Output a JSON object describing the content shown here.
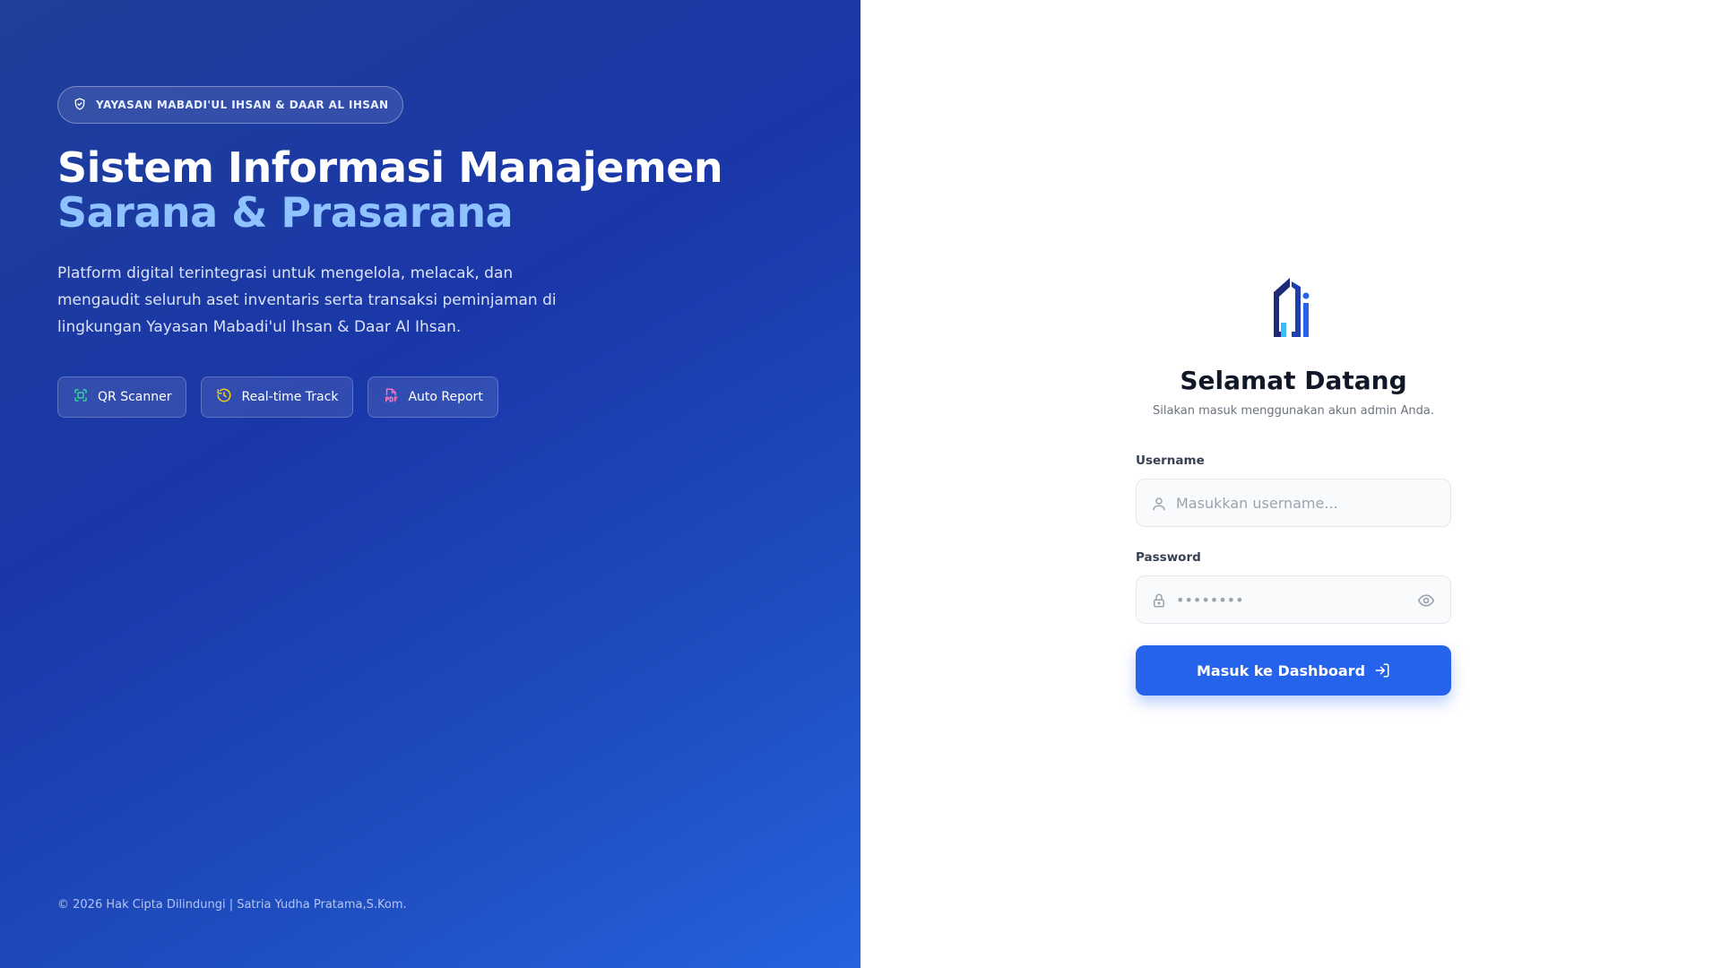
{
  "hero": {
    "badge": {
      "icon": "shield-check-icon",
      "label": "YAYASAN MABADI'UL IHSAN & DAAR AL IHSAN"
    },
    "title_line1": "Sistem Informasi Manajemen",
    "title_line2": "Sarana & Prasarana",
    "description": "Platform digital terintegrasi untuk mengelola, melacak, dan mengaudit seluruh aset inventaris serta transaksi peminjaman di lingkungan Yayasan Mabadi'ul Ihsan & Daar Al Ihsan.",
    "features": [
      {
        "icon": "qr-scan-icon",
        "label": "QR Scanner"
      },
      {
        "icon": "history-icon",
        "label": "Real-time Track"
      },
      {
        "icon": "pdf-file-icon",
        "label": "Auto Report"
      }
    ],
    "copyright": "© 2026 Hak Cipta Dilindungi | Satria Yudha Pratama,S.Kom."
  },
  "login": {
    "logo_icon": "building-logo-icon",
    "title": "Selamat Datang",
    "subtitle": "Silakan masuk menggunakan akun admin Anda.",
    "username_label": "Username",
    "username_placeholder": "Masukkan username...",
    "password_label": "Password",
    "password_placeholder": "••••••••",
    "submit_label": "Masuk ke Dashboard"
  },
  "colors": {
    "accent": "#2563eb",
    "hero_gradient_start": "#1e3f9a",
    "hero_gradient_end": "#2462e0",
    "title_highlight": "#8fc3ff",
    "qr_icon": "#34d399",
    "history_icon": "#facc15",
    "pdf_icon": "#f472b6"
  }
}
